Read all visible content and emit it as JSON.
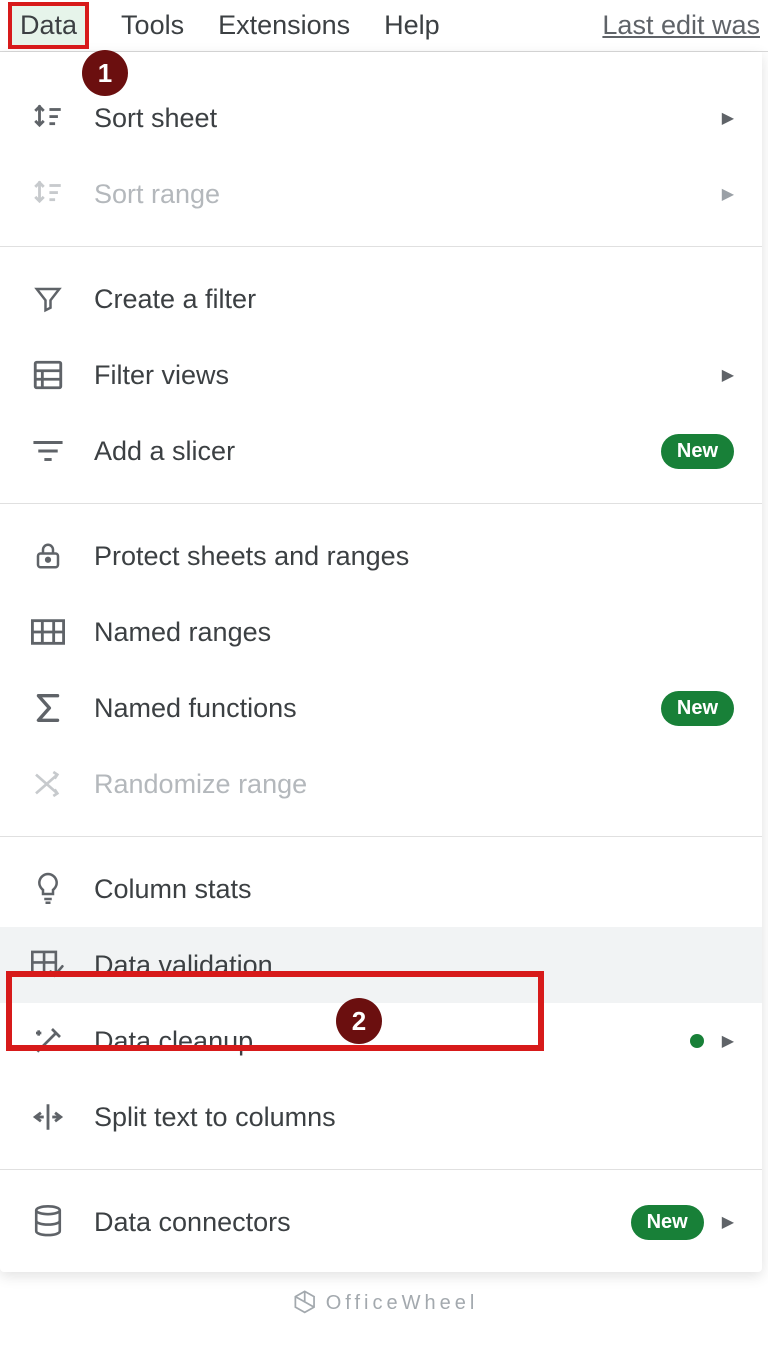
{
  "menubar": {
    "items": [
      "Data",
      "Tools",
      "Extensions",
      "Help"
    ],
    "last_edit": "Last edit was"
  },
  "annotations": {
    "one": "1",
    "two": "2"
  },
  "badges": {
    "new_label": "New"
  },
  "menu": {
    "sort_sheet": "Sort sheet",
    "sort_range": "Sort range",
    "create_filter": "Create a filter",
    "filter_views": "Filter views",
    "add_slicer": "Add a slicer",
    "protect": "Protect sheets and ranges",
    "named_ranges": "Named ranges",
    "named_functions": "Named functions",
    "randomize": "Randomize range",
    "column_stats": "Column stats",
    "data_validation": "Data validation",
    "data_cleanup": "Data cleanup",
    "split_text": "Split text to columns",
    "data_connectors": "Data connectors"
  },
  "watermark": {
    "text": "OfficeWheel"
  }
}
